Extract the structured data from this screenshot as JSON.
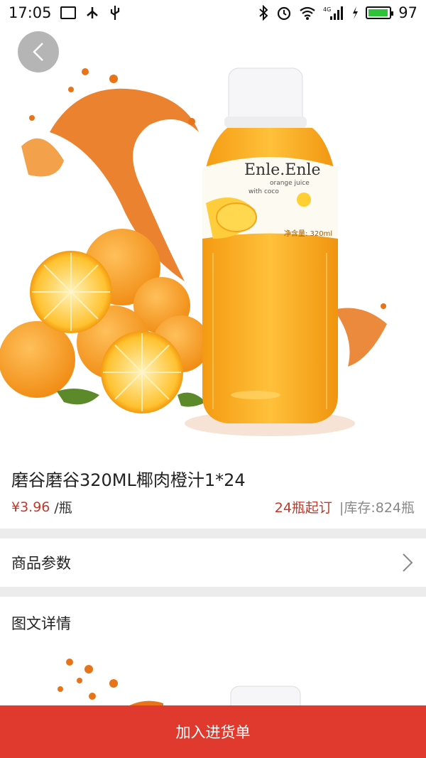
{
  "status_bar": {
    "time": "17:05",
    "battery": "97",
    "battery_level": 0.97,
    "network": "4G",
    "icons": [
      "image-icon",
      "usb-icon",
      "bluetooth-icon",
      "alarm-icon",
      "wifi-icon",
      "signal-icon",
      "charging-icon",
      "battery-icon"
    ]
  },
  "product": {
    "title": "磨谷磨谷320ML椰肉橙汁1*24",
    "price": "¥3.96",
    "unit": "/瓶",
    "min_order": "24瓶起订",
    "stock": "|库存:824瓶",
    "bottle_brand": "Enle.Enle",
    "bottle_sub": "orange juice",
    "bottle_sub2": "with coco",
    "bottle_volume": "净含量: 320ml"
  },
  "sections": {
    "params": "商品参数",
    "details": "图文详情"
  },
  "cta": {
    "add_to_list": "加入进货单"
  },
  "colors": {
    "accent": "#e03a2e",
    "price": "#c0392b"
  }
}
